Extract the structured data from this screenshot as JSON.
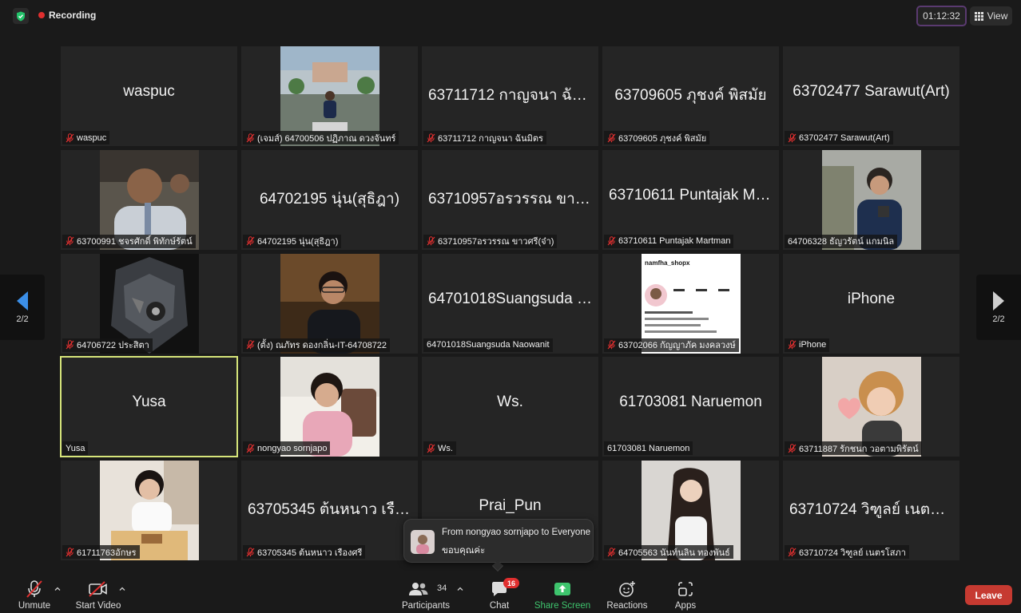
{
  "recording": {
    "label": "Recording"
  },
  "timer": {
    "value": "01:12:32"
  },
  "view": {
    "label": "View"
  },
  "pagination": {
    "left": "2/2",
    "right": "2/2"
  },
  "tiles": [
    {
      "big": "waspuc",
      "label": "waspuc",
      "muted": true,
      "photo": false
    },
    {
      "big": "",
      "label": "(เจมส์) 64700506 ปฏิภาณ ดวงจันทร์",
      "muted": true,
      "photo": true
    },
    {
      "big": "63711712 กาญจนา ฉันมิตร",
      "label": "63711712 กาญจนา ฉันมิตร",
      "muted": true,
      "photo": false
    },
    {
      "big": "63709605 ภุชงค์ พิสมัย",
      "label": "63709605 ภุชงค์ พิสมัย",
      "muted": true,
      "photo": false
    },
    {
      "big": "63702477 Sarawut(Art)",
      "label": "63702477 Sarawut(Art)",
      "muted": true,
      "photo": false
    },
    {
      "big": "",
      "label": "63700991 ชจรศักดิ์ พิทักษ์รัตน์",
      "muted": true,
      "photo": true
    },
    {
      "big": "64702195 นุ่น(สุธิฎา)",
      "label": "64702195 นุ่น(สุธิฎา)",
      "muted": true,
      "photo": false
    },
    {
      "big": "63710957อรวรรณ ขาวศรี(จ๋า)",
      "label": "63710957อรวรรณ ขาวศรี(จ๋า)",
      "muted": true,
      "photo": false
    },
    {
      "big": "63710611 Puntajak Martman",
      "label": "63710611 Puntajak Martman",
      "muted": true,
      "photo": false
    },
    {
      "big": "",
      "label": "64706328 ธัญวรัตน์ แกมนิล",
      "muted": false,
      "photo": true
    },
    {
      "big": "",
      "label": "64706722 ประสิตา",
      "muted": true,
      "photo": true
    },
    {
      "big": "",
      "label": "(ตั้ง) ณภัทร ดองกลิ่น-IT-64708722",
      "muted": true,
      "photo": true
    },
    {
      "big": "64701018Suangsuda Naowanit",
      "label": "64701018Suangsuda Naowanit",
      "muted": false,
      "photo": false
    },
    {
      "big": "",
      "label": "63702066 กัญญาภัค มงคลวงษ์",
      "muted": true,
      "photo": true,
      "photo_text": "namfha_shopx"
    },
    {
      "big": "iPhone",
      "label": "iPhone",
      "muted": true,
      "photo": false
    },
    {
      "big": "Yusa",
      "label": "Yusa",
      "muted": false,
      "photo": false,
      "active": true
    },
    {
      "big": "",
      "label": "nongyao sornjapo",
      "muted": true,
      "photo": true
    },
    {
      "big": "Ws.",
      "label": "Ws.",
      "muted": true,
      "photo": false
    },
    {
      "big": "61703081 Naruemon",
      "label": "61703081 Naruemon",
      "muted": false,
      "photo": false
    },
    {
      "big": "",
      "label": "63711887 รักชนก วอตามพิรัตน์",
      "muted": true,
      "photo": true
    },
    {
      "big": "",
      "label": "61711763อักษร",
      "muted": true,
      "photo": true
    },
    {
      "big": "63705345 ต้นหนาว เรืองศรี",
      "label": "63705345 ต้นหนาว เรืองศรี",
      "muted": true,
      "photo": false
    },
    {
      "big": "Prai_Pun",
      "label": "",
      "muted": false,
      "photo": false
    },
    {
      "big": "",
      "label": "64705563 นันท์นลิน ทองพันธ์",
      "muted": true,
      "photo": true
    },
    {
      "big": "63710724 วิฑูลย์ เนตรโสภา",
      "label": "63710724 วิฑูลย์ เนตรโสภา",
      "muted": true,
      "photo": false
    }
  ],
  "chat_toast": {
    "from": "From nongyao sornjapo to Everyone",
    "message": "ขอบคุณค่ะ"
  },
  "toolbar": {
    "unmute": "Unmute",
    "start_video": "Start Video",
    "participants": "Participants",
    "participants_count": "34",
    "chat": "Chat",
    "chat_badge": "16",
    "share_screen": "Share Screen",
    "reactions": "Reactions",
    "apps": "Apps",
    "leave": "Leave"
  },
  "colors": {
    "background": "#1a1a1a",
    "tile": "#252525",
    "active_speaker": "#d6e57a",
    "record_dot": "#e02f2f",
    "share_green": "#3ec46d",
    "leave_red": "#c63a31"
  }
}
